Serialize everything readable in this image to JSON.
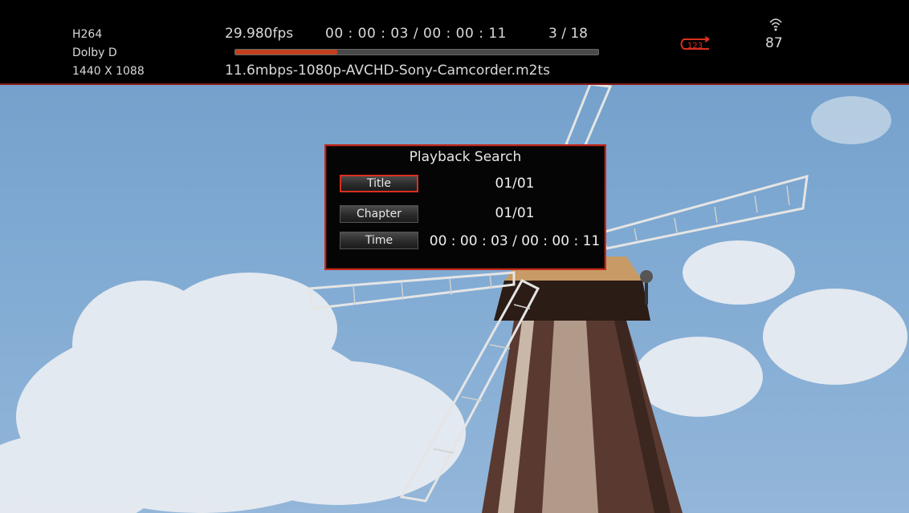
{
  "info": {
    "codec": "H264",
    "audio": "Dolby D",
    "resolution": "1440 X 1088",
    "fps": "29.980fps",
    "time": "00 : 00 : 03  /  00 : 00 : 11",
    "track": "3 / 18",
    "filename": "11.6mbps-1080p-AVCHD-Sony-Camcorder.m2ts",
    "progress_fraction": 0.28,
    "repeat_icon_text": "123",
    "signal": "87"
  },
  "icons": {
    "repeat": "repeat-123-icon",
    "wifi": "wifi-icon"
  },
  "colors": {
    "accent": "#c32a1d",
    "progress": "#c2401e"
  },
  "dialog": {
    "title": "Playback Search",
    "rows": [
      {
        "label": "Title",
        "value": "01/01"
      },
      {
        "label": "Chapter",
        "value": "01/01"
      },
      {
        "label": "Time",
        "value": "00 : 00 : 03  /  00 : 00 : 11"
      }
    ]
  }
}
